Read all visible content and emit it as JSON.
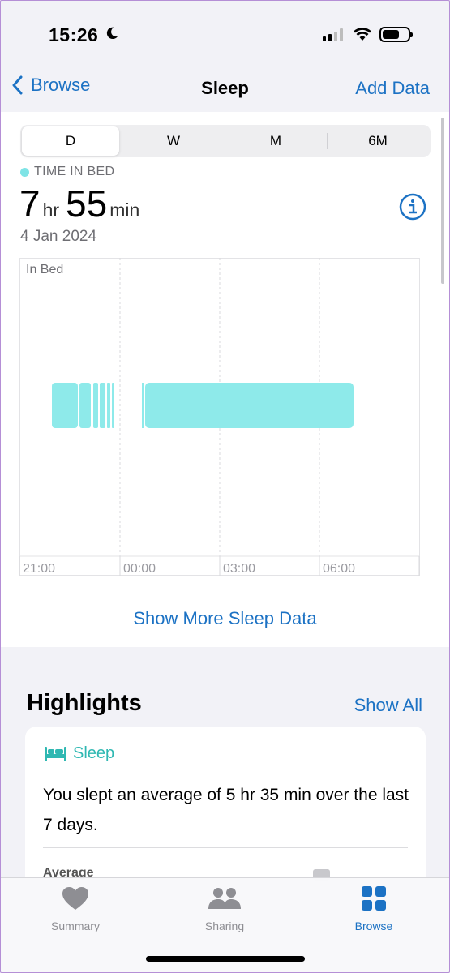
{
  "status": {
    "time": "15:26"
  },
  "nav": {
    "back_label": "Browse",
    "title": "Sleep",
    "add_label": "Add Data"
  },
  "segments": [
    "D",
    "W",
    "M",
    "6M"
  ],
  "selected_segment": "D",
  "metric": {
    "label": "TIME IN BED",
    "hours": "7",
    "hours_unit": "hr",
    "minutes": "55",
    "minutes_unit": "min",
    "date": "4 Jan 2024"
  },
  "chart": {
    "legend_label": "In Bed",
    "x_ticks": [
      "21:00",
      "00:00",
      "03:00",
      "06:00"
    ],
    "color": "#8eeaea"
  },
  "show_more_label": "Show More Sleep Data",
  "highlights": {
    "title": "Highlights",
    "show_all_label": "Show All",
    "card": {
      "category": "Sleep",
      "text": "You slept an average of 5 hr 35 min over the last 7 days.",
      "sub_label": "Average"
    }
  },
  "tabs": [
    {
      "label": "Summary",
      "icon": "heart-icon"
    },
    {
      "label": "Sharing",
      "icon": "people-icon"
    },
    {
      "label": "Browse",
      "icon": "grid-icon"
    }
  ],
  "active_tab": "Browse",
  "colors": {
    "accent": "#1c72c4",
    "sleep": "#8eeaea",
    "sleep_text": "#2fb8b2"
  }
}
